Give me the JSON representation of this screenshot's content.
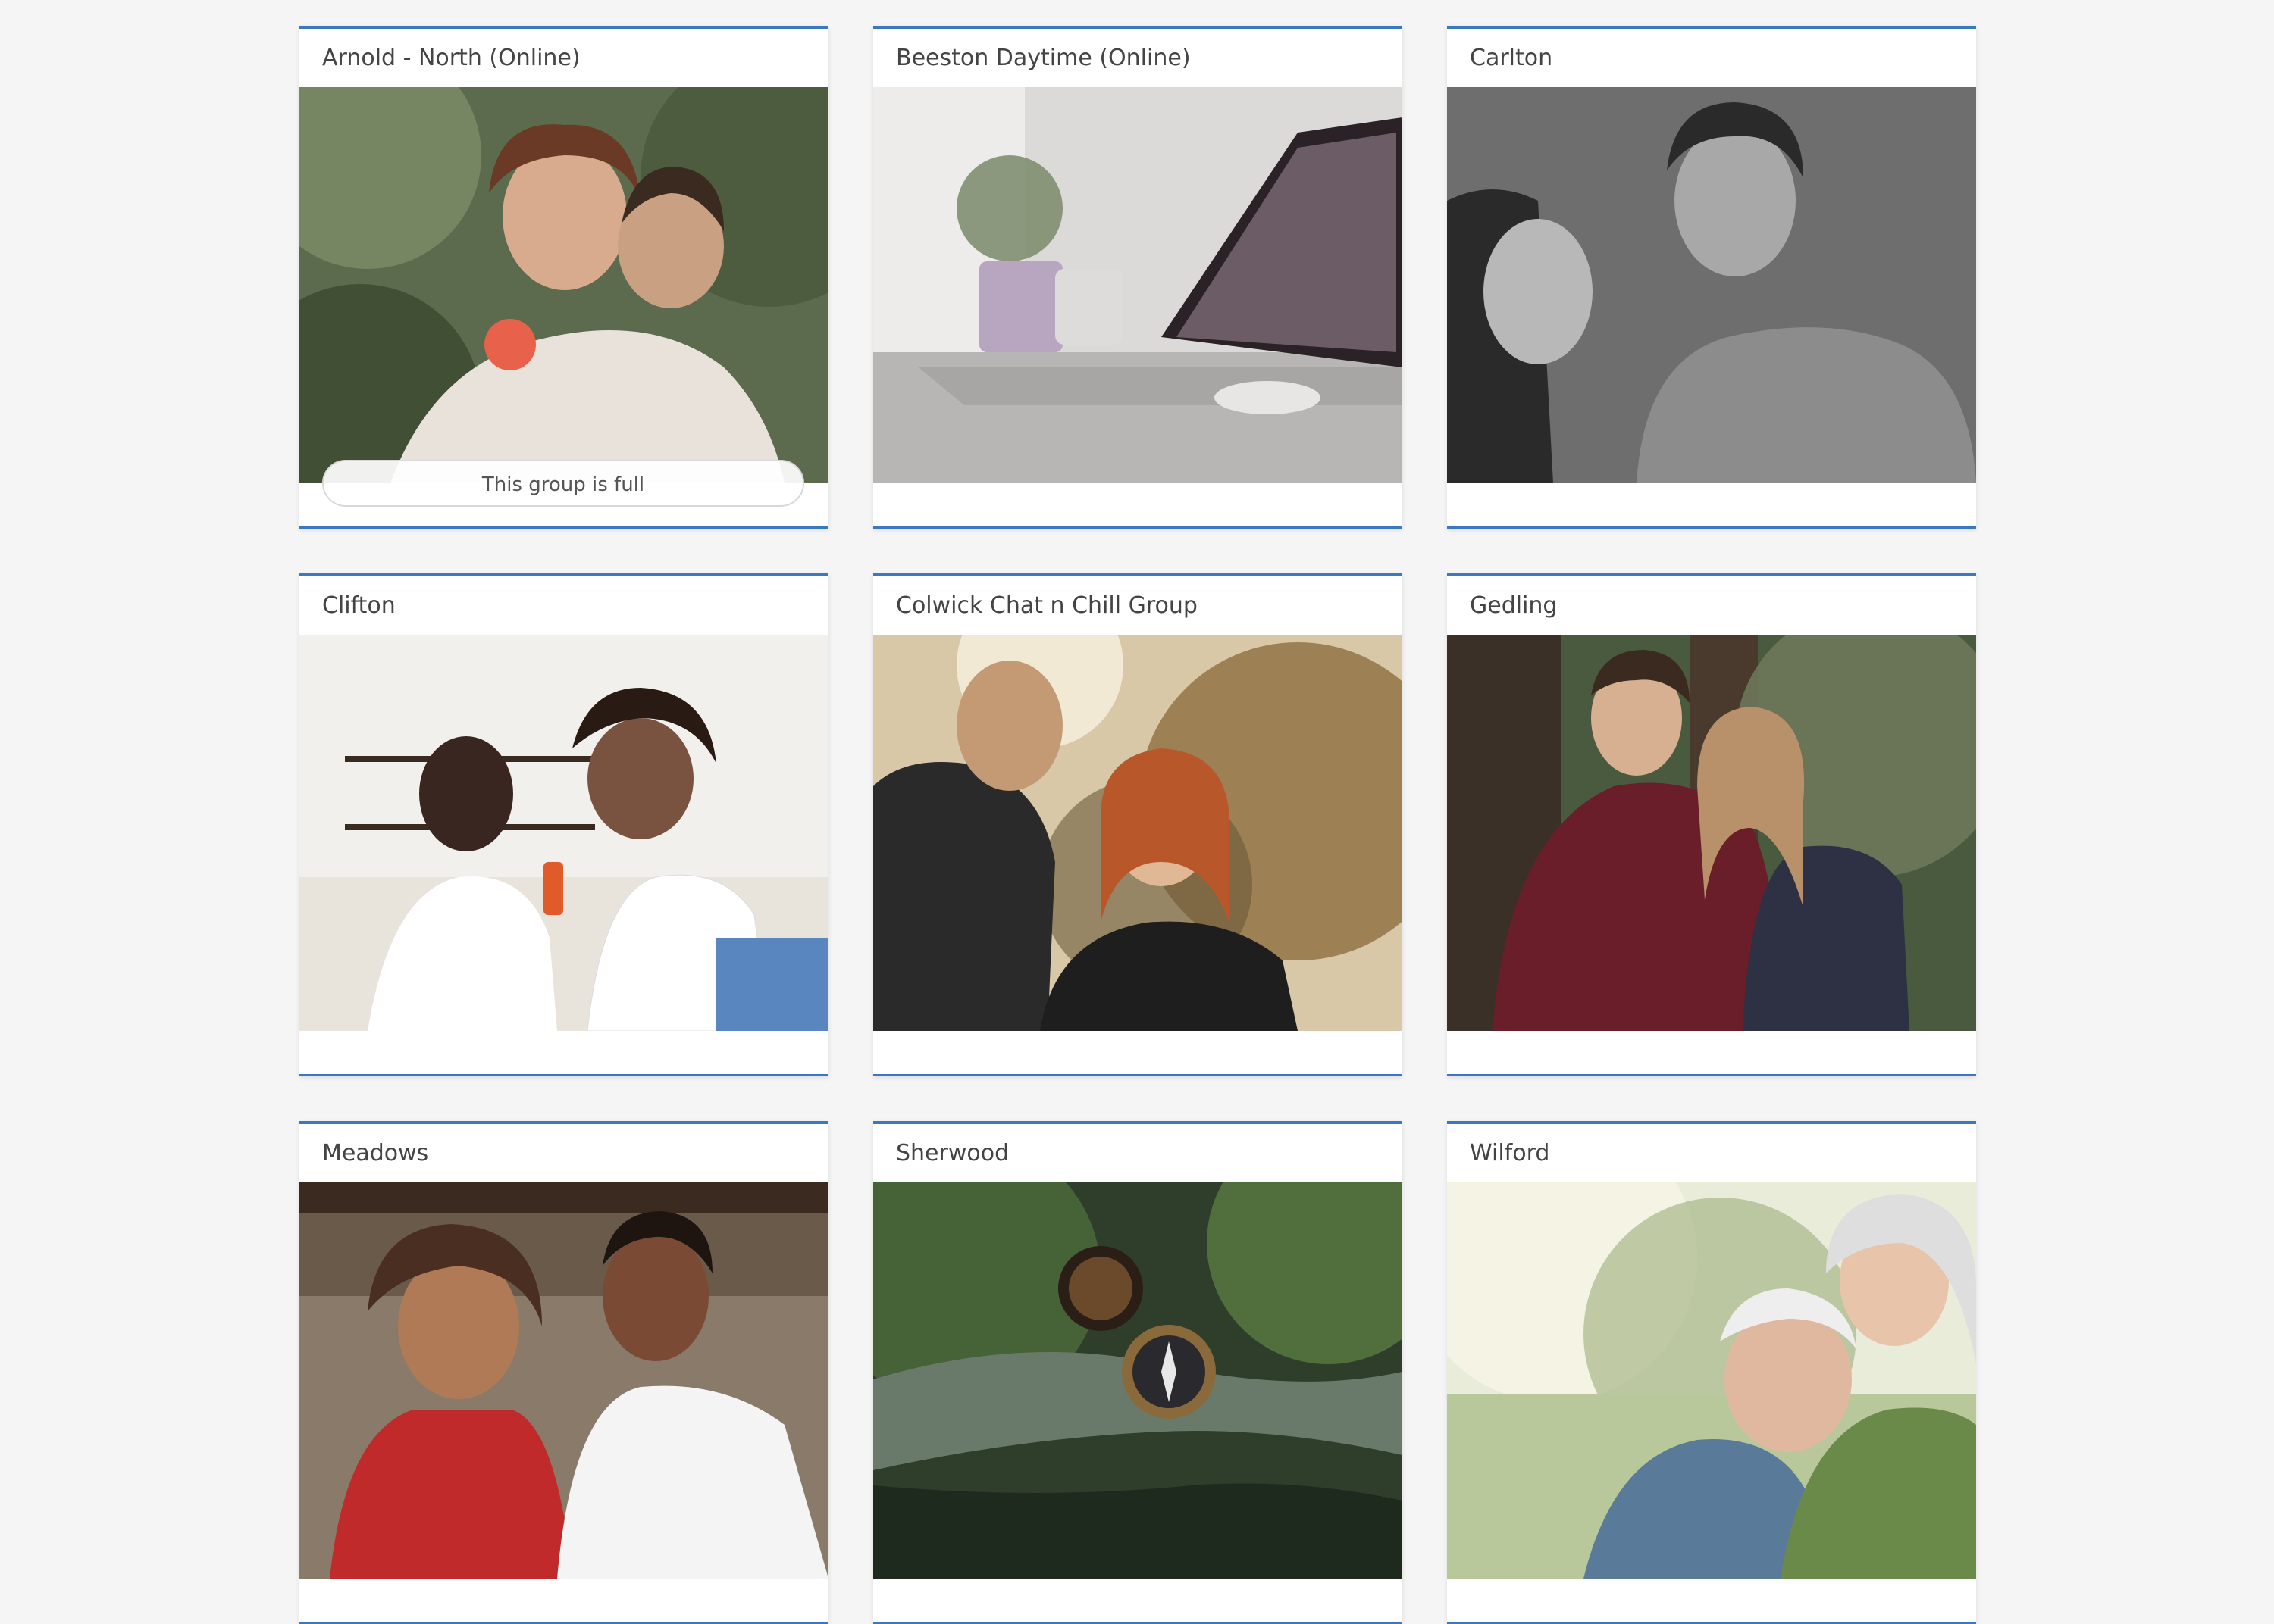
{
  "groups": [
    {
      "name": "Arnold - North (Online)",
      "status": "This group is full",
      "photo": "couple-piggyback-outdoors",
      "palette": [
        "#5c6b4e",
        "#8a9a7a",
        "#e8e2da",
        "#c9a98a",
        "#e8614a"
      ]
    },
    {
      "name": "Beeston Daytime (Online)",
      "status": "",
      "photo": "laptop-on-desk",
      "palette": [
        "#d8d6d4",
        "#a8a6a4",
        "#6b5c66",
        "#b8a6c0",
        "#f2f0ee"
      ]
    },
    {
      "name": "Carlton",
      "status": "",
      "photo": "couple-black-and-white",
      "palette": [
        "#6e6e6e",
        "#4a4a4a",
        "#2a2a2a",
        "#b8b8b8",
        "#8c8c8c"
      ]
    },
    {
      "name": "Clifton",
      "status": "",
      "photo": "couple-on-sofa",
      "palette": [
        "#f2f0ec",
        "#e8e4dc",
        "#3a2a22",
        "#5a86c0",
        "#ffffff"
      ]
    },
    {
      "name": "Colwick Chat n Chill Group",
      "status": "",
      "photo": "couple-at-sunset",
      "palette": [
        "#b89a6a",
        "#6a5a3a",
        "#d8c8a8",
        "#e8d0b0",
        "#2a2a2a"
      ]
    },
    {
      "name": "Gedling",
      "status": "",
      "photo": "couple-in-forest",
      "palette": [
        "#4a5a3e",
        "#6e7a5a",
        "#6a1e2a",
        "#3a3a4a",
        "#d8c0a8"
      ]
    },
    {
      "name": "Meadows",
      "status": "",
      "photo": "couple-smiling",
      "palette": [
        "#6a5a4a",
        "#8a7a6a",
        "#c02a2a",
        "#f4f4f4",
        "#4a2e22"
      ]
    },
    {
      "name": "Sherwood",
      "status": "",
      "photo": "compass-by-stream",
      "palette": [
        "#2e3e2a",
        "#4a6a3a",
        "#6a7a6a",
        "#8a6a3a",
        "#1e2a1e"
      ]
    },
    {
      "name": "Wilford",
      "status": "",
      "photo": "older-couple-outdoors",
      "palette": [
        "#e8ecd8",
        "#a8b88a",
        "#d8c8b0",
        "#6a8a4a",
        "#f4e8dc"
      ]
    }
  ]
}
